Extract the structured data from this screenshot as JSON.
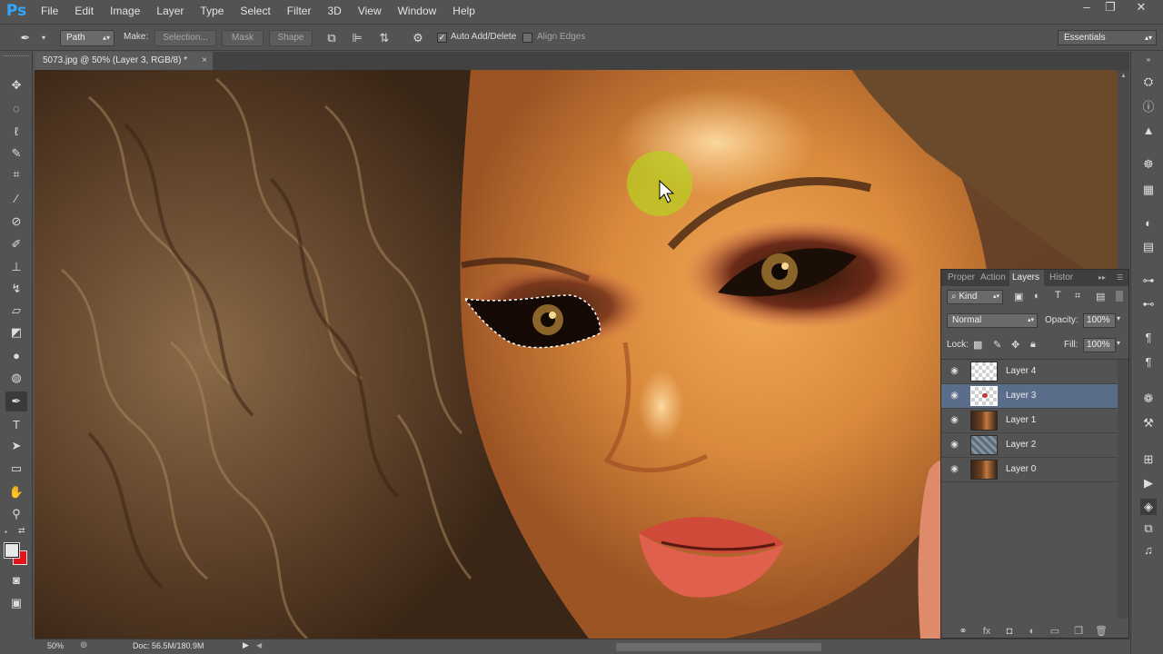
{
  "app": {
    "logo": "Ps"
  },
  "menu": [
    "File",
    "Edit",
    "Image",
    "Layer",
    "Type",
    "Select",
    "Filter",
    "3D",
    "View",
    "Window",
    "Help"
  ],
  "window_controls": {
    "minimize": "–",
    "restore": "❐",
    "close": "✕"
  },
  "options": {
    "mode_value": "Path",
    "make_label": "Make:",
    "selection_button": "Selection...",
    "mask_button": "Mask",
    "shape_button": "Shape",
    "auto_add_delete_label": "Auto Add/Delete",
    "auto_add_delete_checked": true,
    "align_edges_label": "Align Edges",
    "align_edges_checked": false,
    "workspace": "Essentials"
  },
  "document": {
    "tab_title": "5073.jpg @ 50% (Layer 3, RGB/8) *",
    "close": "×"
  },
  "status": {
    "zoom": "50%",
    "doc_size": "Doc: 56.5M/180.9M"
  },
  "layers_panel": {
    "tabs": [
      "Proper",
      "Action",
      "Layers",
      "Histor"
    ],
    "active_tab": "Layers",
    "filter_kind": "Kind",
    "blend_mode": "Normal",
    "opacity_label": "Opacity:",
    "opacity": "100%",
    "lock_label": "Lock:",
    "fill_label": "Fill:",
    "fill": "100%",
    "layers": [
      {
        "name": "Layer 4",
        "selected": false,
        "thumb": "transparent"
      },
      {
        "name": "Layer 3",
        "selected": true,
        "thumb": "transparent-eye"
      },
      {
        "name": "Layer 1",
        "selected": false,
        "thumb": "portrait"
      },
      {
        "name": "Layer 2",
        "selected": false,
        "thumb": "texture"
      },
      {
        "name": "Layer 0",
        "selected": false,
        "thumb": "portrait"
      }
    ]
  },
  "colors": {
    "foreground": "#e8e8e8",
    "background": "#e8141c",
    "selected_layer": "#5a6e8c",
    "ps_blue": "#31a8ff"
  }
}
